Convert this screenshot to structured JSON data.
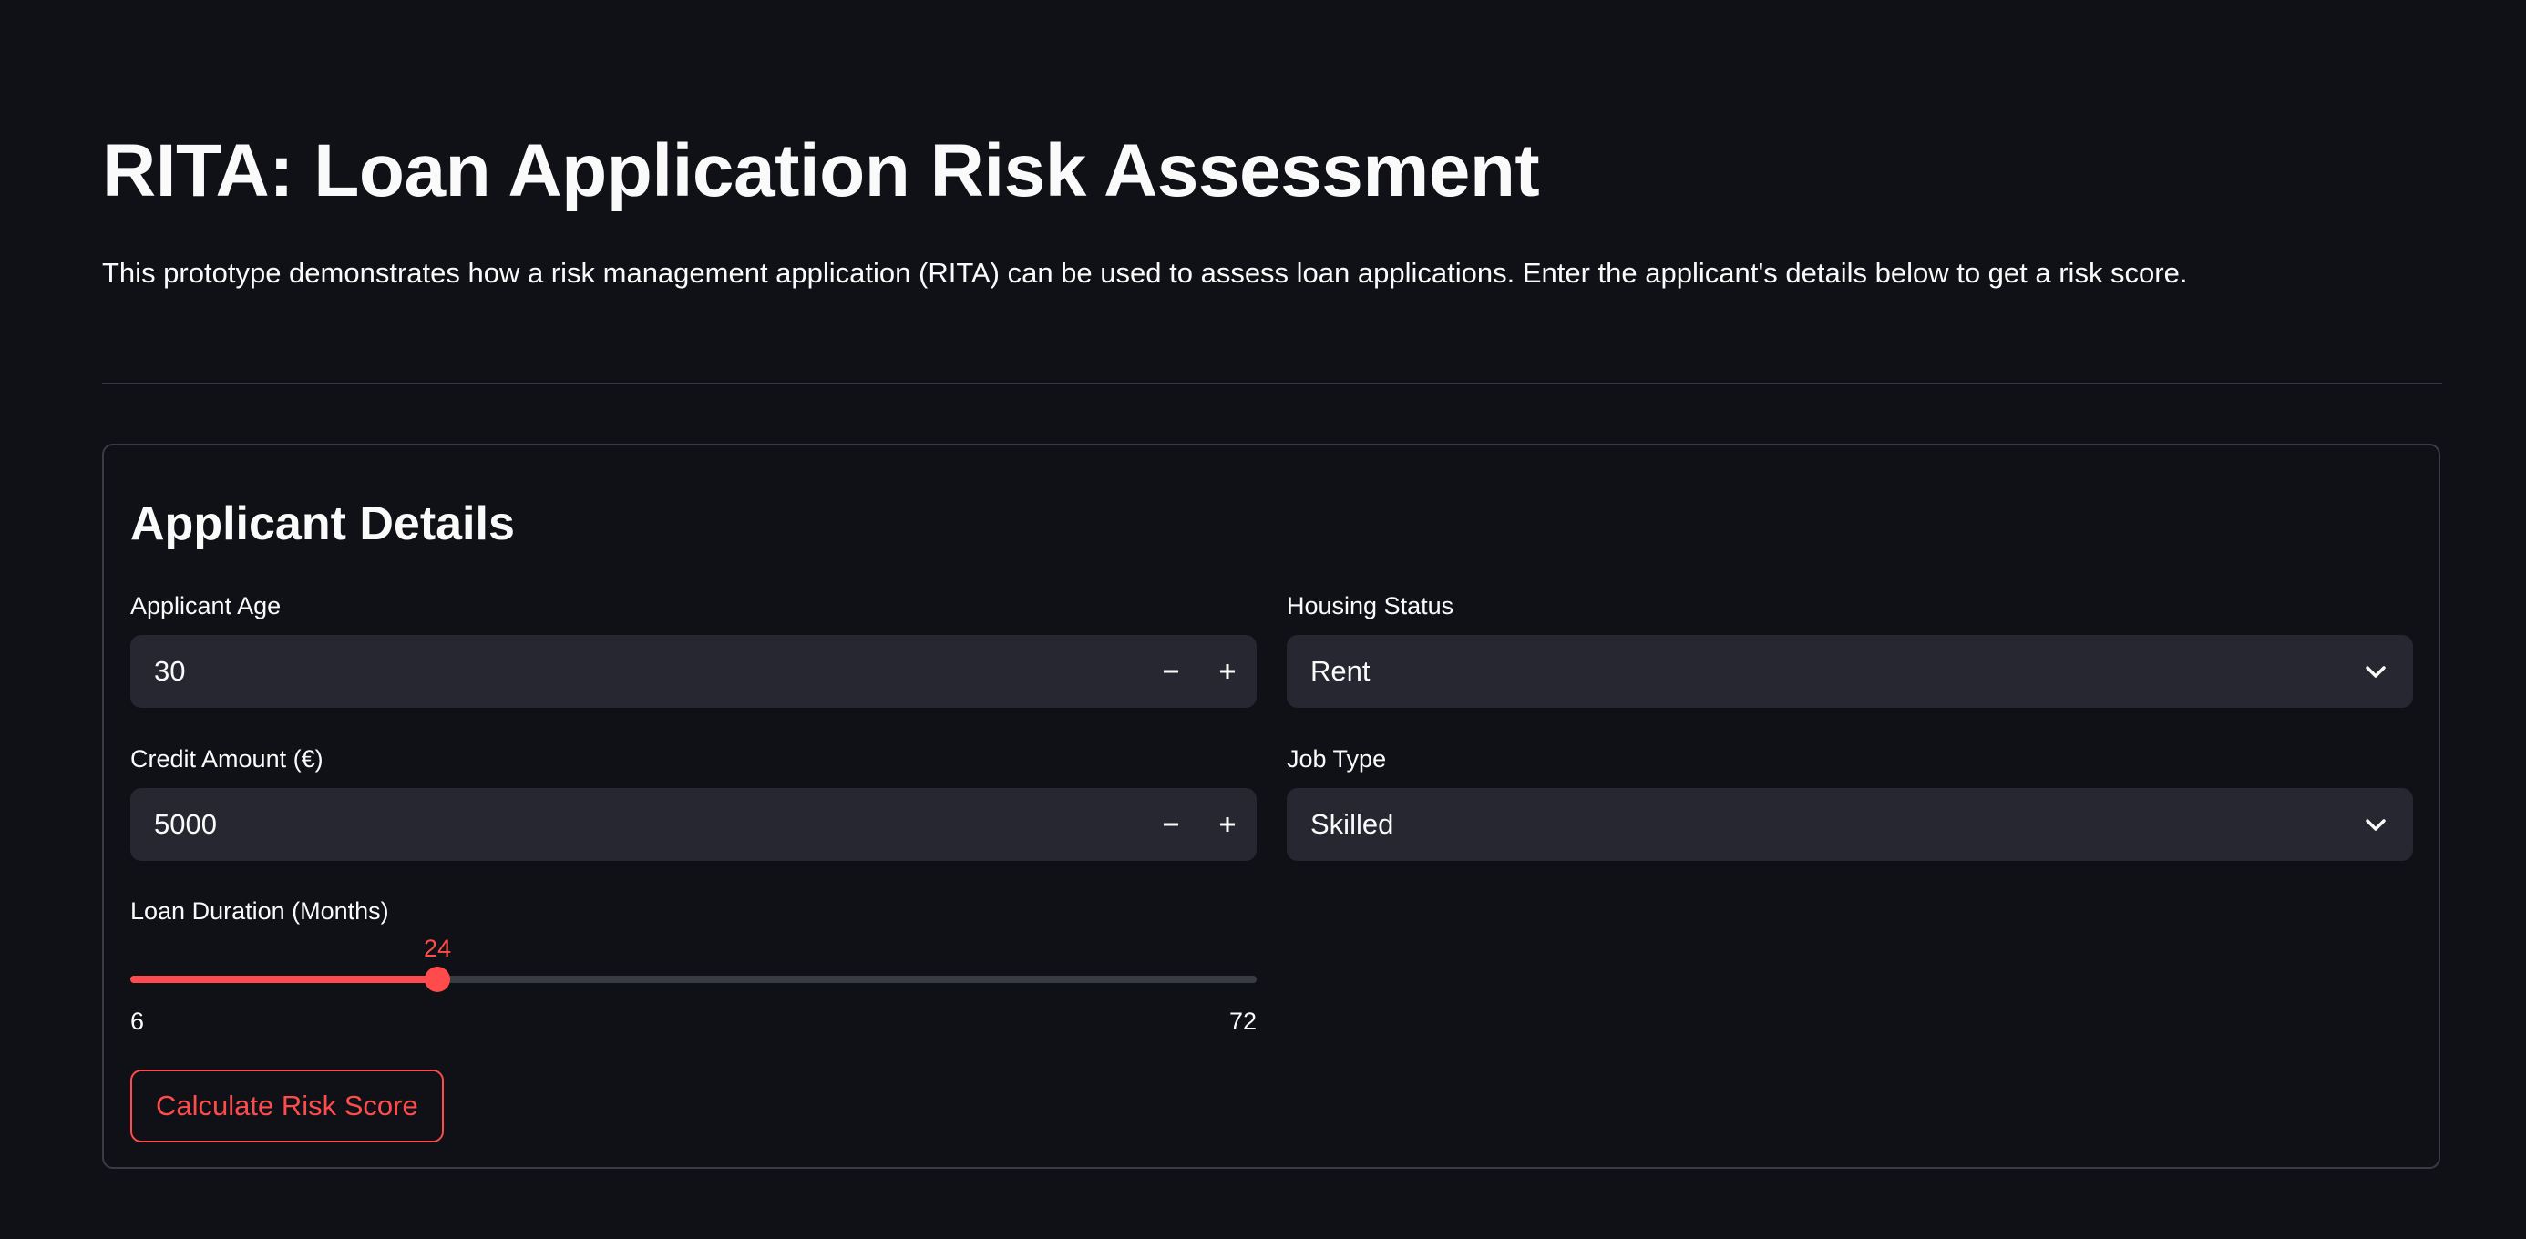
{
  "header": {
    "title": "RITA: Loan Application Risk Assessment",
    "intro": "This prototype demonstrates how a risk management application (RITA) can be used to assess loan applications. Enter the applicant's details below to get a risk score."
  },
  "form": {
    "heading": "Applicant Details",
    "applicant_age": {
      "label": "Applicant Age",
      "value": "30",
      "decrement_icon": "minus-icon",
      "increment_icon": "plus-icon"
    },
    "credit_amount": {
      "label": "Credit Amount (€)",
      "value": "5000",
      "decrement_icon": "minus-icon",
      "increment_icon": "plus-icon"
    },
    "housing_status": {
      "label": "Housing Status",
      "value": "Rent",
      "icon": "chevron-down-icon"
    },
    "job_type": {
      "label": "Job Type",
      "value": "Skilled",
      "icon": "chevron-down-icon"
    },
    "loan_duration": {
      "label": "Loan Duration (Months)",
      "value": 24,
      "min": 6,
      "max": 72
    },
    "submit_label": "Calculate Risk Score"
  },
  "colors": {
    "background": "#0f1116",
    "input_background": "#262730",
    "accent": "#ff4b4b",
    "border": "#3a3c44",
    "text": "#fafafa"
  }
}
